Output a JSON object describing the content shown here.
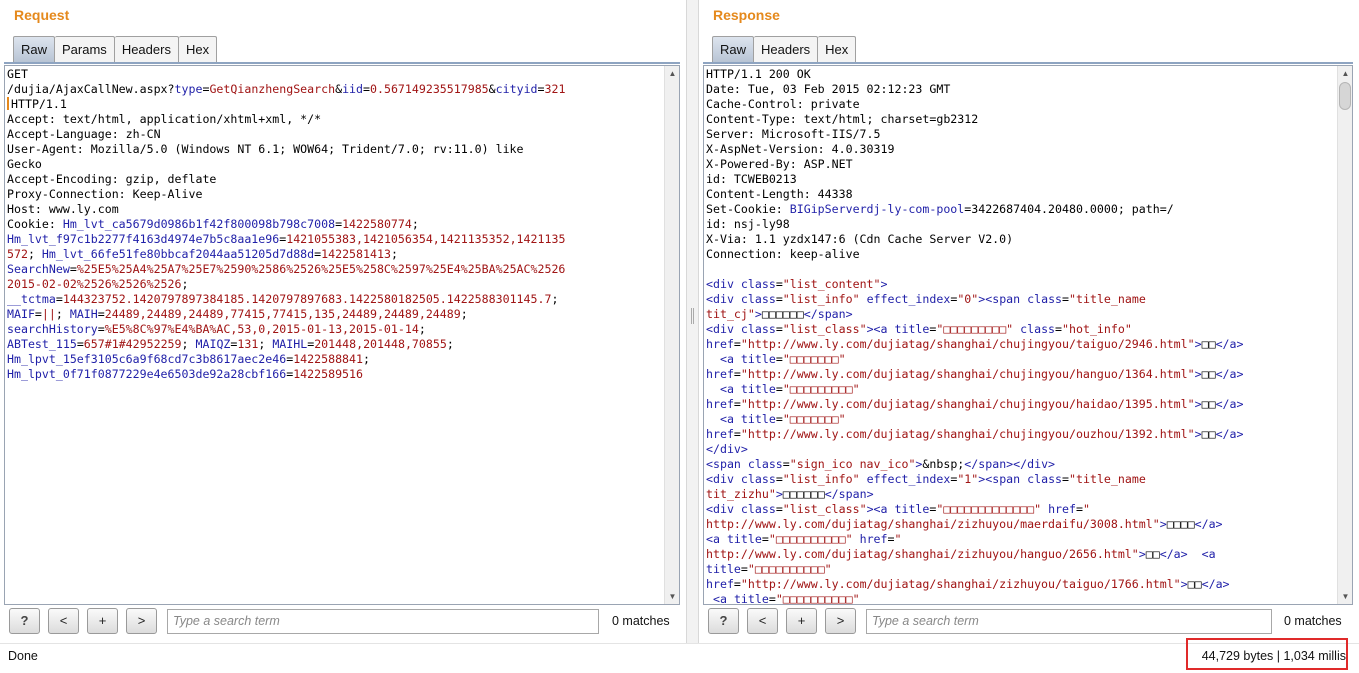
{
  "request": {
    "title": "Request",
    "tabs": [
      "Raw",
      "Params",
      "Headers",
      "Hex"
    ],
    "search_placeholder": "Type a search term",
    "matches": "0 matches",
    "lines": [
      [
        [
          "",
          "GET"
        ]
      ],
      [
        [
          "",
          "/dujia/AjaxCallNew.aspx?"
        ],
        [
          "p",
          "type"
        ],
        [
          "",
          "="
        ],
        [
          "v",
          "GetQianzhengSearch"
        ],
        [
          "",
          "&"
        ],
        [
          "p",
          "iid"
        ],
        [
          "",
          "="
        ],
        [
          "v",
          "0.567149235517985"
        ],
        [
          "",
          "&"
        ],
        [
          "p",
          "cityid"
        ],
        [
          "",
          "="
        ],
        [
          "v",
          "321"
        ]
      ],
      [
        [
          "c",
          ""
        ],
        [
          "",
          "HTTP/1.1"
        ]
      ],
      [
        [
          "",
          "Accept: text/html, application/xhtml+xml, */*"
        ]
      ],
      [
        [
          "",
          "Accept-Language: zh-CN"
        ]
      ],
      [
        [
          "",
          "User-Agent: Mozilla/5.0 (Windows NT 6.1; WOW64; Trident/7.0; rv:11.0) like"
        ]
      ],
      [
        [
          "",
          "Gecko"
        ]
      ],
      [
        [
          "",
          "Accept-Encoding: gzip, deflate"
        ]
      ],
      [
        [
          "",
          "Proxy-Connection: Keep-Alive"
        ]
      ],
      [
        [
          "",
          "Host: www.ly.com"
        ]
      ],
      [
        [
          "",
          "Cookie: "
        ],
        [
          "p",
          "Hm_lvt_ca5679d0986b1f42f800098b798c7008"
        ],
        [
          "",
          "="
        ],
        [
          "v",
          "1422580774"
        ],
        [
          "",
          ";"
        ]
      ],
      [
        [
          "p",
          "Hm_lvt_f97c1b2277f4163d4974e7b5c8aa1e96"
        ],
        [
          "",
          "="
        ],
        [
          "v",
          "1421055383,1421056354,1421135352,1421135"
        ]
      ],
      [
        [
          "v",
          "572"
        ],
        [
          "",
          "; "
        ],
        [
          "p",
          "Hm_lvt_66fe51fe80bbcaf2044aa51205d7d88d"
        ],
        [
          "",
          "="
        ],
        [
          "v",
          "1422581413"
        ],
        [
          "",
          ";"
        ]
      ],
      [
        [
          "p",
          "SearchNew"
        ],
        [
          "",
          "="
        ],
        [
          "v",
          "%25E5%25A4%25A7%25E7%2590%2586%2526%25E5%258C%2597%25E4%25BA%25AC%2526"
        ]
      ],
      [
        [
          "v",
          "2015-02-02%2526%2526%2526"
        ],
        [
          "",
          ";"
        ]
      ],
      [
        [
          "p",
          "__tctma"
        ],
        [
          "",
          "="
        ],
        [
          "v",
          "144323752.1420797897384185.1420797897683.1422580182505.1422588301145.7"
        ],
        [
          "",
          ";"
        ]
      ],
      [
        [
          "p",
          "MAIF"
        ],
        [
          "",
          "="
        ],
        [
          "v",
          "||"
        ],
        [
          "",
          "; "
        ],
        [
          "p",
          "MAIH"
        ],
        [
          "",
          "="
        ],
        [
          "v",
          "24489,24489,24489,77415,77415,135,24489,24489,24489"
        ],
        [
          "",
          ";"
        ]
      ],
      [
        [
          "p",
          "searchHistory"
        ],
        [
          "",
          "="
        ],
        [
          "v",
          "%E5%8C%97%E4%BA%AC,53,0,2015-01-13,2015-01-14"
        ],
        [
          "",
          ";"
        ]
      ],
      [
        [
          "p",
          "ABTest_115"
        ],
        [
          "",
          "="
        ],
        [
          "v",
          "657#1#42952259"
        ],
        [
          "",
          "; "
        ],
        [
          "p",
          "MAIQZ"
        ],
        [
          "",
          "="
        ],
        [
          "v",
          "131"
        ],
        [
          "",
          "; "
        ],
        [
          "p",
          "MAIHL"
        ],
        [
          "",
          "="
        ],
        [
          "v",
          "201448,201448,70855"
        ],
        [
          "",
          ";"
        ]
      ],
      [
        [
          "p",
          "Hm_lpvt_15ef3105c6a9f68cd7c3b8617aec2e46"
        ],
        [
          "",
          "="
        ],
        [
          "v",
          "1422588841"
        ],
        [
          "",
          ";"
        ]
      ],
      [
        [
          "p",
          "Hm_lpvt_0f71f0877229e4e6503de92a28cbf166"
        ],
        [
          "",
          "="
        ],
        [
          "v",
          "1422589516"
        ]
      ]
    ]
  },
  "response": {
    "title": "Response",
    "tabs": [
      "Raw",
      "Headers",
      "Hex"
    ],
    "search_placeholder": "Type a search term",
    "matches": "0 matches",
    "lines": [
      [
        [
          "",
          "HTTP/1.1 200 OK"
        ]
      ],
      [
        [
          "",
          "Date: Tue, 03 Feb 2015 02:12:23 GMT"
        ]
      ],
      [
        [
          "",
          "Cache-Control: private"
        ]
      ],
      [
        [
          "",
          "Content-Type: text/html; charset=gb2312"
        ]
      ],
      [
        [
          "",
          "Server: Microsoft-IIS/7.5"
        ]
      ],
      [
        [
          "",
          "X-AspNet-Version: 4.0.30319"
        ]
      ],
      [
        [
          "",
          "X-Powered-By: ASP.NET"
        ]
      ],
      [
        [
          "",
          "id: TCWEB0213"
        ]
      ],
      [
        [
          "",
          "Content-Length: 44338"
        ]
      ],
      [
        [
          "",
          "Set-Cookie: "
        ],
        [
          "p",
          "BIGipServerdj-ly-com-pool"
        ],
        [
          "",
          "=3422687404.20480.0000; path=/"
        ]
      ],
      [
        [
          "",
          "id: nsj-ly98"
        ]
      ],
      [
        [
          "",
          "X-Via: 1.1 yzdx147:6 (Cdn Cache Server V2.0)"
        ]
      ],
      [
        [
          "",
          "Connection: keep-alive"
        ]
      ],
      [
        [
          "",
          ""
        ]
      ],
      [
        [
          "p",
          "<div "
        ],
        [
          "p",
          "class"
        ],
        [
          "",
          "="
        ],
        [
          "v",
          "\"list_content\""
        ],
        [
          "p",
          ">"
        ]
      ],
      [
        [
          "p",
          "<div "
        ],
        [
          "p",
          "class"
        ],
        [
          "",
          "="
        ],
        [
          "v",
          "\"list_info\""
        ],
        [
          "",
          " "
        ],
        [
          "p",
          "effect_index"
        ],
        [
          "",
          "="
        ],
        [
          "v",
          "\"0\""
        ],
        [
          "p",
          "><span "
        ],
        [
          "p",
          "class"
        ],
        [
          "",
          "="
        ],
        [
          "v",
          "\"title_name"
        ]
      ],
      [
        [
          "v",
          "tit_cj\""
        ],
        [
          "p",
          ">"
        ],
        [
          "",
          "□□□□□□"
        ],
        [
          "p",
          "</span>"
        ]
      ],
      [
        [
          "p",
          "<div "
        ],
        [
          "p",
          "class"
        ],
        [
          "",
          "="
        ],
        [
          "v",
          "\"list_class\""
        ],
        [
          "p",
          "><a "
        ],
        [
          "p",
          "title"
        ],
        [
          "",
          "="
        ],
        [
          "v",
          "\"□□□□□□□□□\""
        ],
        [
          "",
          " "
        ],
        [
          "p",
          "class"
        ],
        [
          "",
          "="
        ],
        [
          "v",
          "\"hot_info\""
        ]
      ],
      [
        [
          "p",
          "href"
        ],
        [
          "",
          "="
        ],
        [
          "v",
          "\"http://www.ly.com/dujiatag/shanghai/chujingyou/taiguo/2946.html\""
        ],
        [
          "p",
          ">"
        ],
        [
          "",
          "□□"
        ],
        [
          "p",
          "</a>"
        ]
      ],
      [
        [
          "",
          "  "
        ],
        [
          "p",
          "<a "
        ],
        [
          "p",
          "title"
        ],
        [
          "",
          "="
        ],
        [
          "v",
          "\"□□□□□□□\""
        ]
      ],
      [
        [
          "p",
          "href"
        ],
        [
          "",
          "="
        ],
        [
          "v",
          "\"http://www.ly.com/dujiatag/shanghai/chujingyou/hanguo/1364.html\""
        ],
        [
          "p",
          ">"
        ],
        [
          "",
          "□□"
        ],
        [
          "p",
          "</a>"
        ]
      ],
      [
        [
          "",
          "  "
        ],
        [
          "p",
          "<a "
        ],
        [
          "p",
          "title"
        ],
        [
          "",
          "="
        ],
        [
          "v",
          "\"□□□□□□□□□\""
        ]
      ],
      [
        [
          "p",
          "href"
        ],
        [
          "",
          "="
        ],
        [
          "v",
          "\"http://www.ly.com/dujiatag/shanghai/chujingyou/haidao/1395.html\""
        ],
        [
          "p",
          ">"
        ],
        [
          "",
          "□□"
        ],
        [
          "p",
          "</a>"
        ]
      ],
      [
        [
          "",
          "  "
        ],
        [
          "p",
          "<a "
        ],
        [
          "p",
          "title"
        ],
        [
          "",
          "="
        ],
        [
          "v",
          "\"□□□□□□□\""
        ]
      ],
      [
        [
          "p",
          "href"
        ],
        [
          "",
          "="
        ],
        [
          "v",
          "\"http://www.ly.com/dujiatag/shanghai/chujingyou/ouzhou/1392.html\""
        ],
        [
          "p",
          ">"
        ],
        [
          "",
          "□□"
        ],
        [
          "p",
          "</a>"
        ]
      ],
      [
        [
          "p",
          "</div>"
        ]
      ],
      [
        [
          "p",
          "<span "
        ],
        [
          "p",
          "class"
        ],
        [
          "",
          "="
        ],
        [
          "v",
          "\"sign_ico nav_ico\""
        ],
        [
          "p",
          ">"
        ],
        [
          "",
          "&nbsp;"
        ],
        [
          "p",
          "</span></div>"
        ]
      ],
      [
        [
          "p",
          "<div "
        ],
        [
          "p",
          "class"
        ],
        [
          "",
          "="
        ],
        [
          "v",
          "\"list_info\""
        ],
        [
          "",
          " "
        ],
        [
          "p",
          "effect_index"
        ],
        [
          "",
          "="
        ],
        [
          "v",
          "\"1\""
        ],
        [
          "p",
          "><span "
        ],
        [
          "p",
          "class"
        ],
        [
          "",
          "="
        ],
        [
          "v",
          "\"title_name"
        ]
      ],
      [
        [
          "v",
          "tit_zizhu\""
        ],
        [
          "p",
          ">"
        ],
        [
          "",
          "□□□□□□"
        ],
        [
          "p",
          "</span>"
        ]
      ],
      [
        [
          "p",
          "<div "
        ],
        [
          "p",
          "class"
        ],
        [
          "",
          "="
        ],
        [
          "v",
          "\"list_class\""
        ],
        [
          "p",
          "><a "
        ],
        [
          "p",
          "title"
        ],
        [
          "",
          "="
        ],
        [
          "v",
          "\"□□□□□□□□□□□□□\""
        ],
        [
          "",
          " "
        ],
        [
          "p",
          "href"
        ],
        [
          "",
          "="
        ],
        [
          "v",
          "\""
        ]
      ],
      [
        [
          "v",
          "http://www.ly.com/dujiatag/shanghai/zizhuyou/maerdaifu/3008.html\""
        ],
        [
          "p",
          ">"
        ],
        [
          "",
          "□□□□"
        ],
        [
          "p",
          "</a>"
        ]
      ],
      [
        [
          "p",
          "<a "
        ],
        [
          "p",
          "title"
        ],
        [
          "",
          "="
        ],
        [
          "v",
          "\"□□□□□□□□□□\""
        ],
        [
          "",
          " "
        ],
        [
          "p",
          "href"
        ],
        [
          "",
          "="
        ],
        [
          "v",
          "\""
        ]
      ],
      [
        [
          "v",
          "http://www.ly.com/dujiatag/shanghai/zizhuyou/hanguo/2656.html\""
        ],
        [
          "p",
          ">"
        ],
        [
          "",
          "□□"
        ],
        [
          "p",
          "</a>"
        ],
        [
          "",
          "  "
        ],
        [
          "p",
          "<a"
        ]
      ],
      [
        [
          "p",
          "title"
        ],
        [
          "",
          "="
        ],
        [
          "v",
          "\"□□□□□□□□□□\""
        ]
      ],
      [
        [
          "p",
          "href"
        ],
        [
          "",
          "="
        ],
        [
          "v",
          "\"http://www.ly.com/dujiatag/shanghai/zizhuyou/taiguo/1766.html\""
        ],
        [
          "p",
          ">"
        ],
        [
          "",
          "□□"
        ],
        [
          "p",
          "</a>"
        ]
      ],
      [
        [
          "",
          " "
        ],
        [
          "p",
          "<a "
        ],
        [
          "p",
          "title"
        ],
        [
          "",
          "="
        ],
        [
          "v",
          "\"□□□□□□□□□□\""
        ]
      ]
    ]
  },
  "status": {
    "left": "Done",
    "right": "44,729 bytes | 1,034 millis"
  },
  "colors": {
    "title": "#e5891c",
    "param": "#1f1fa8",
    "value": "#a01414",
    "highlight": "#e02a2a"
  }
}
